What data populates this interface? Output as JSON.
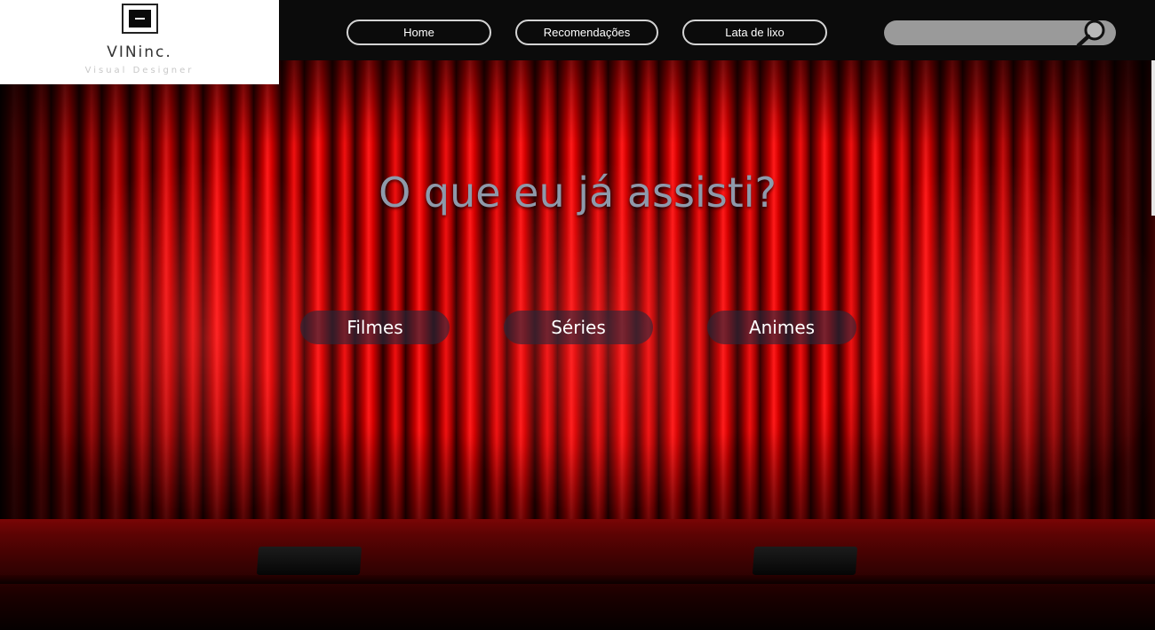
{
  "brand": {
    "name": "VINinc.",
    "tagline": "Visual Designer"
  },
  "nav": {
    "home": "Home",
    "recommendations": "Recomendações",
    "trash": "Lata de lixo"
  },
  "search": {
    "value": "",
    "placeholder": "",
    "icon": "magnifier-icon"
  },
  "hero": {
    "title": "O que eu já assisti?"
  },
  "categories": [
    {
      "label": "Filmes"
    },
    {
      "label": "Séries"
    },
    {
      "label": "Animes"
    }
  ],
  "colors": {
    "header_bg": "#0b0b0b",
    "nav_border": "#d4d4d4",
    "search_bg": "#9a9a9a",
    "title_color": "#8e99aa",
    "curtain_red": "#e00000"
  }
}
